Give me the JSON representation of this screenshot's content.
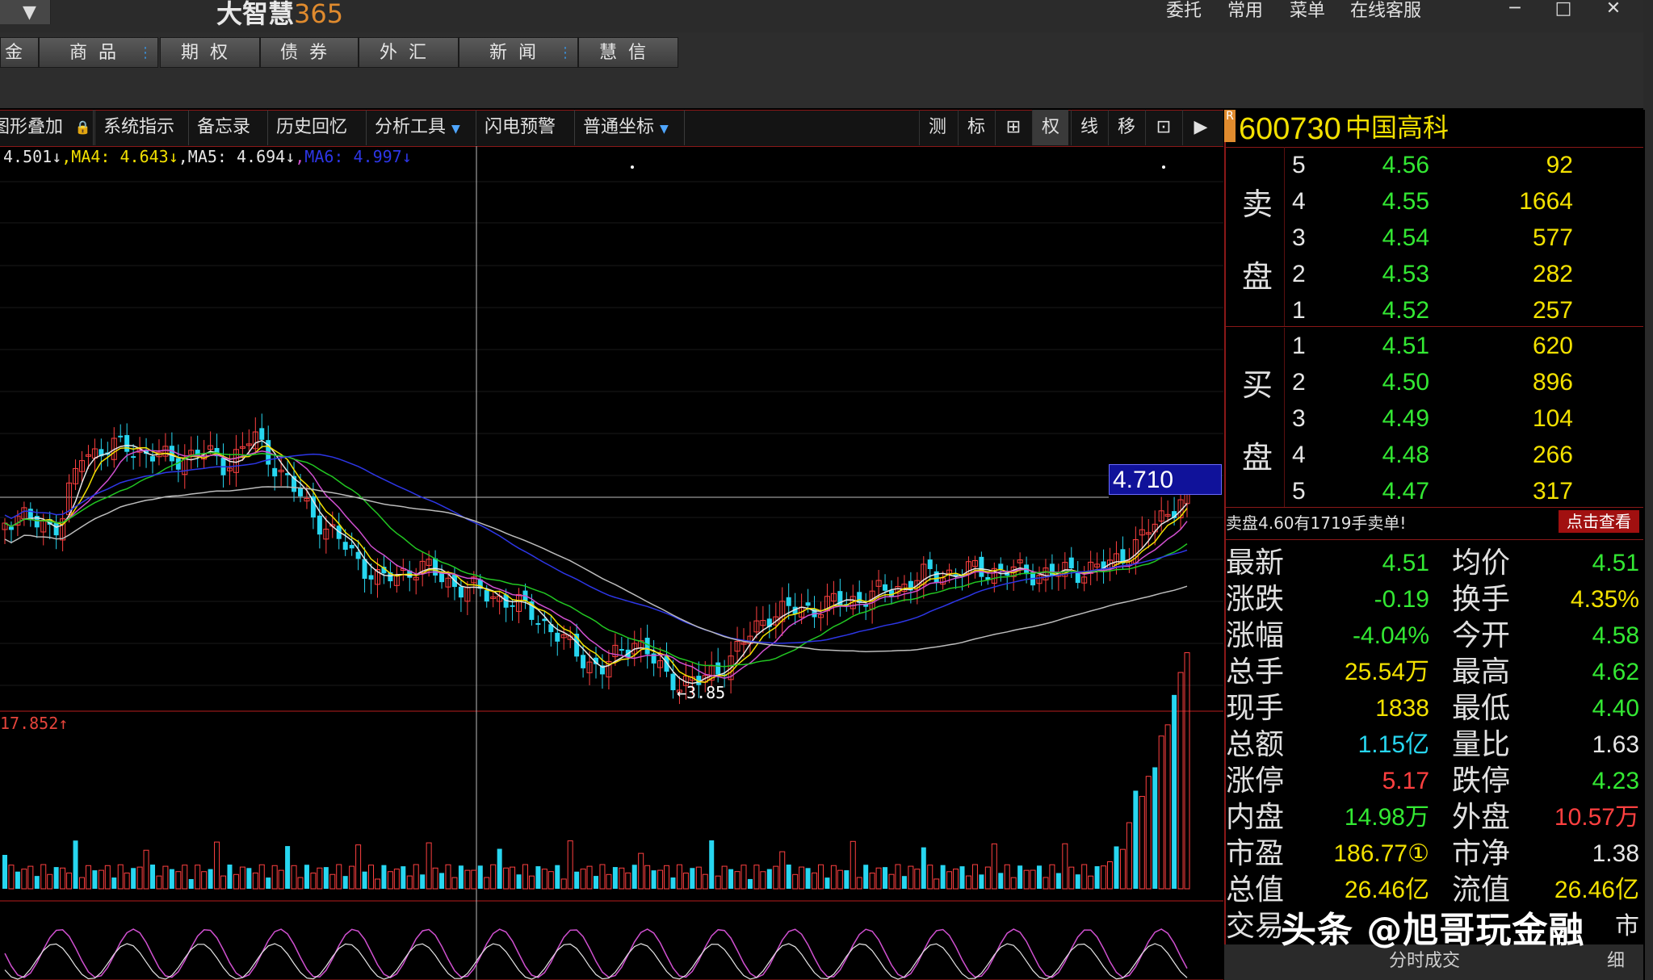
{
  "app": {
    "title_text": "大智慧",
    "title_num": "365"
  },
  "top_menu": [
    "委托",
    "常用",
    "菜单",
    "在线客服"
  ],
  "window_controls": [
    "─",
    "□",
    "✕"
  ],
  "tabs": [
    {
      "label": "金",
      "dot": false
    },
    {
      "label": "商品",
      "dot": true
    },
    {
      "label": "期权",
      "dot": false
    },
    {
      "label": "债券",
      "dot": false
    },
    {
      "label": "外汇",
      "dot": false
    },
    {
      "label": "新闻",
      "dot": true
    },
    {
      "label": "慧信",
      "dot": false
    }
  ],
  "toolbar": {
    "items": [
      "图形叠加",
      "系统指示",
      "备忘录",
      "历史回忆",
      "分析工具",
      "闪电预警",
      "普通坐标"
    ],
    "icons": [
      "测",
      "标",
      "⊞",
      "权",
      "线",
      "移",
      "⊡",
      "▶"
    ]
  },
  "ma_legend": {
    "ma3": "4.501↓",
    "ma4": "MA4: 4.643↓",
    "ma5": "MA5: 4.694↓",
    "ma6": "MA6: 4.997↓"
  },
  "vol_legend": "17.852↑",
  "low_label": "←3.85",
  "price_cursor": "4.710",
  "stock": {
    "code": "600730",
    "name": "中国高科",
    "badge": "R"
  },
  "sell_label": [
    "卖",
    "盘"
  ],
  "buy_label": [
    "买",
    "盘"
  ],
  "sell": [
    {
      "level": "5",
      "price": "4.56",
      "vol": "92"
    },
    {
      "level": "4",
      "price": "4.55",
      "vol": "1664"
    },
    {
      "level": "3",
      "price": "4.54",
      "vol": "577"
    },
    {
      "level": "2",
      "price": "4.53",
      "vol": "282"
    },
    {
      "level": "1",
      "price": "4.52",
      "vol": "257"
    }
  ],
  "buy": [
    {
      "level": "1",
      "price": "4.51",
      "vol": "620"
    },
    {
      "level": "2",
      "price": "4.50",
      "vol": "896"
    },
    {
      "level": "3",
      "price": "4.49",
      "vol": "104"
    },
    {
      "level": "4",
      "price": "4.48",
      "vol": "266"
    },
    {
      "level": "5",
      "price": "4.47",
      "vol": "317"
    }
  ],
  "notice": {
    "text": "卖盘4.60有1719手卖单!",
    "button": "点击查看"
  },
  "stats": [
    {
      "l1": "最新",
      "v1": "4.51",
      "c1": "#33e833",
      "l2": "均价",
      "v2": "4.51",
      "c2": "#33e833"
    },
    {
      "l1": "涨跌",
      "v1": "-0.19",
      "c1": "#33e833",
      "l2": "换手",
      "v2": "4.35%",
      "c2": "#f3e100"
    },
    {
      "l1": "涨幅",
      "v1": "-4.04%",
      "c1": "#33e833",
      "l2": "今开",
      "v2": "4.58",
      "c2": "#33e833"
    },
    {
      "l1": "总手",
      "v1": "25.54万",
      "c1": "#f3e100",
      "l2": "最高",
      "v2": "4.62",
      "c2": "#33e833"
    },
    {
      "l1": "现手",
      "v1": "1838",
      "c1": "#f3e100",
      "l2": "最低",
      "v2": "4.40",
      "c2": "#33e833"
    },
    {
      "l1": "总额",
      "v1": "1.15亿",
      "c1": "#27d6f0",
      "l2": "量比",
      "v2": "1.63",
      "c2": "#e6e6e6"
    },
    {
      "l1": "涨停",
      "v1": "5.17",
      "c1": "#ff4040",
      "l2": "跌停",
      "v2": "4.23",
      "c2": "#33e833"
    },
    {
      "l1": "内盘",
      "v1": "14.98万",
      "c1": "#33e833",
      "l2": "外盘",
      "v2": "10.57万",
      "c2": "#ff4040"
    },
    {
      "l1": "市盈",
      "v1": "186.77①",
      "c1": "#f3e100",
      "l2": "市净",
      "v2": "1.38",
      "c2": "#e6e6e6"
    },
    {
      "l1": "总值",
      "v1": "26.46亿",
      "c1": "#f3e100",
      "l2": "流值",
      "v2": "26.46亿",
      "c2": "#f3e100"
    },
    {
      "l1": "交易",
      "v1": "",
      "c1": "#f3e100",
      "l2": "",
      "v2": "市",
      "c2": "#e6e6e6"
    }
  ],
  "bottom_tabs": [
    "分时成交",
    "细"
  ],
  "watermark": "头条 @旭哥玩金融",
  "colors": {
    "up": "#ff4040",
    "down": "#33e833",
    "cyan": "#27d6f0",
    "yellow": "#f3e100",
    "border_red": "#8a1818"
  }
}
